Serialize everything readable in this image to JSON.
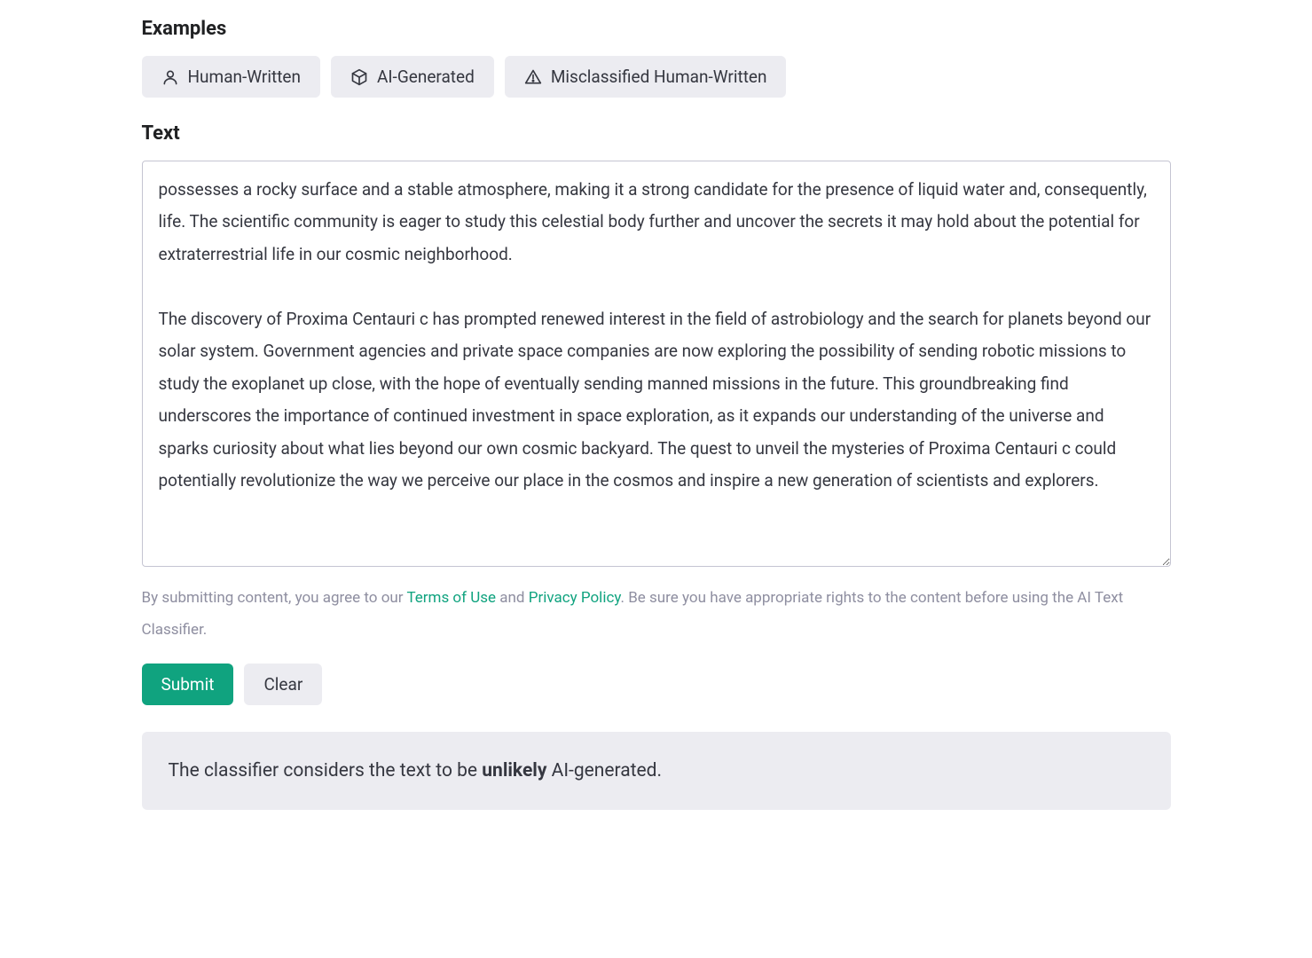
{
  "sections": {
    "examples_title": "Examples",
    "text_title": "Text"
  },
  "examples": {
    "human_written": "Human-Written",
    "ai_generated": "AI-Generated",
    "misclassified": "Misclassified Human-Written"
  },
  "input": {
    "text_value": "possesses a rocky surface and a stable atmosphere, making it a strong candidate for the presence of liquid water and, consequently, life. The scientific community is eager to study this celestial body further and uncover the secrets it may hold about the potential for extraterrestrial life in our cosmic neighborhood.\n\nThe discovery of Proxima Centauri c has prompted renewed interest in the field of astrobiology and the search for planets beyond our solar system. Government agencies and private space companies are now exploring the possibility of sending robotic missions to study the exoplanet up close, with the hope of eventually sending manned missions in the future. This groundbreaking find underscores the importance of continued investment in space exploration, as it expands our understanding of the universe and sparks curiosity about what lies beyond our own cosmic backyard. The quest to unveil the mysteries of Proxima Centauri c could potentially revolutionize the way we perceive our place in the cosmos and inspire a new generation of scientists and explorers."
  },
  "disclaimer": {
    "prefix": "By submitting content, you agree to our ",
    "terms": "Terms of Use",
    "mid": " and ",
    "privacy": "Privacy Policy",
    "suffix": ". Be sure you have appropriate rights to the content before using the AI Text Classifier."
  },
  "actions": {
    "submit": "Submit",
    "clear": "Clear"
  },
  "result": {
    "prefix": "The classifier considers the text to be ",
    "verdict": "unlikely",
    "suffix": " AI-generated."
  }
}
